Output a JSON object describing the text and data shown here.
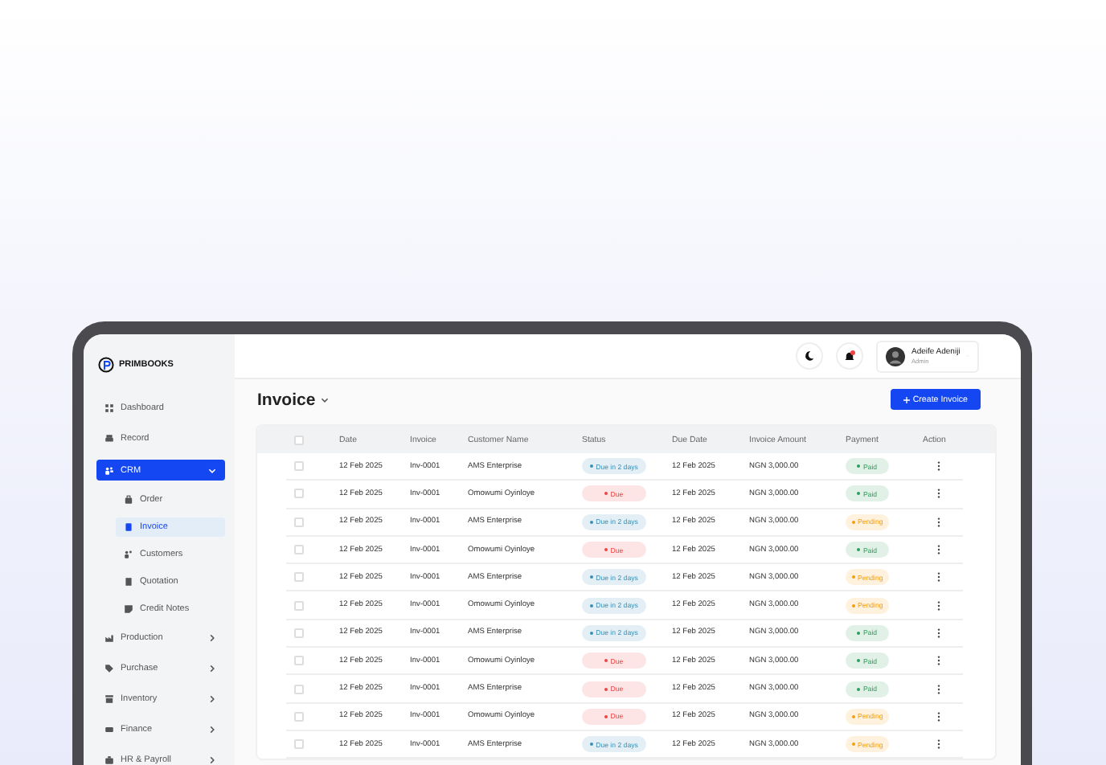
{
  "sidebar": {
    "brand": "PRIMBOOKS",
    "items": [
      {
        "label": "Dashboard",
        "kind": "link",
        "selected": false
      },
      {
        "label": "Record",
        "kind": "link",
        "selected": false
      },
      {
        "label": "CRM",
        "kind": "group",
        "selected": true,
        "expanded": true,
        "children": [
          {
            "label": "Order",
            "selected": false
          },
          {
            "label": "Invoice",
            "selected": true
          },
          {
            "label": "Customers",
            "selected": false
          },
          {
            "label": "Quotation",
            "selected": false
          },
          {
            "label": "Credit Notes",
            "selected": false
          }
        ]
      },
      {
        "label": "Production",
        "kind": "group",
        "selected": false,
        "expanded": false
      },
      {
        "label": "Purchase",
        "kind": "group",
        "selected": false,
        "expanded": false
      },
      {
        "label": "Inventory",
        "kind": "group",
        "selected": false,
        "expanded": false
      },
      {
        "label": "Finance",
        "kind": "group",
        "selected": false,
        "expanded": false
      },
      {
        "label": "HR & Payroll",
        "kind": "group",
        "selected": false,
        "expanded": false
      }
    ]
  },
  "topbar": {
    "user": {
      "name": "Adeife Adeniji",
      "role": "Admin"
    },
    "notification": true
  },
  "page": {
    "title": "Invoice",
    "create_button": "Create Invoice"
  },
  "table": {
    "select_all_checked": false,
    "columns": [
      "Date",
      "Invoice",
      "Customer Name",
      "Status",
      "Due Date",
      "Invoice Amount",
      "Payment",
      "Action"
    ],
    "rows": [
      {
        "checked": false,
        "date": "12 Feb 2025",
        "invoice": "Inv-0001",
        "customer": "AMS Enterprise",
        "status": {
          "text": "Due in 2 days",
          "color": "#3a8fb7"
        },
        "due_date": "12 Feb 2025",
        "amount": "NGN 3,000.00",
        "payment": {
          "text": "Paid",
          "color": "#2f9e5a"
        }
      },
      {
        "checked": false,
        "date": "12 Feb 2025",
        "invoice": "Inv-0001",
        "customer": "Omowumi Oyinloye",
        "status": {
          "text": "Due",
          "color": "#ef4444"
        },
        "due_date": "12 Feb 2025",
        "amount": "NGN 3,000.00",
        "payment": {
          "text": "Paid",
          "color": "#2f9e5a"
        }
      },
      {
        "checked": false,
        "date": "12 Feb 2025",
        "invoice": "Inv-0001",
        "customer": "AMS Enterprise",
        "status": {
          "text": "Due in 2 days",
          "color": "#3a8fb7"
        },
        "due_date": "12 Feb 2025",
        "amount": "NGN 3,000.00",
        "payment": {
          "text": "Pending",
          "color": "#f59e0b"
        }
      },
      {
        "checked": false,
        "date": "12 Feb 2025",
        "invoice": "Inv-0001",
        "customer": "Omowumi Oyinloye",
        "status": {
          "text": "Due",
          "color": "#ef4444"
        },
        "due_date": "12 Feb 2025",
        "amount": "NGN 3,000.00",
        "payment": {
          "text": "Paid",
          "color": "#2f9e5a"
        }
      },
      {
        "checked": false,
        "date": "12 Feb 2025",
        "invoice": "Inv-0001",
        "customer": "AMS Enterprise",
        "status": {
          "text": "Due in 2 days",
          "color": "#3a8fb7"
        },
        "due_date": "12 Feb 2025",
        "amount": "NGN 3,000.00",
        "payment": {
          "text": "Pending",
          "color": "#f59e0b"
        }
      },
      {
        "checked": false,
        "date": "12 Feb 2025",
        "invoice": "Inv-0001",
        "customer": "Omowumi Oyinloye",
        "status": {
          "text": "Due in 2 days",
          "color": "#3a8fb7"
        },
        "due_date": "12 Feb 2025",
        "amount": "NGN 3,000.00",
        "payment": {
          "text": "Pending",
          "color": "#f59e0b"
        }
      },
      {
        "checked": false,
        "date": "12 Feb 2025",
        "invoice": "Inv-0001",
        "customer": "AMS Enterprise",
        "status": {
          "text": "Due in 2 days",
          "color": "#3a8fb7"
        },
        "due_date": "12 Feb 2025",
        "amount": "NGN 3,000.00",
        "payment": {
          "text": "Paid",
          "color": "#2f9e5a"
        }
      },
      {
        "checked": false,
        "date": "12 Feb 2025",
        "invoice": "Inv-0001",
        "customer": "Omowumi Oyinloye",
        "status": {
          "text": "Due",
          "color": "#ef4444"
        },
        "due_date": "12 Feb 2025",
        "amount": "NGN 3,000.00",
        "payment": {
          "text": "Paid",
          "color": "#2f9e5a"
        }
      },
      {
        "checked": false,
        "date": "12 Feb 2025",
        "invoice": "Inv-0001",
        "customer": "AMS Enterprise",
        "status": {
          "text": "Due",
          "color": "#ef4444"
        },
        "due_date": "12 Feb 2025",
        "amount": "NGN 3,000.00",
        "payment": {
          "text": "Paid",
          "color": "#2f9e5a"
        }
      },
      {
        "checked": false,
        "date": "12 Feb 2025",
        "invoice": "Inv-0001",
        "customer": "Omowumi Oyinloye",
        "status": {
          "text": "Due",
          "color": "#ef4444"
        },
        "due_date": "12 Feb 2025",
        "amount": "NGN 3,000.00",
        "payment": {
          "text": "Pending",
          "color": "#f59e0b"
        }
      },
      {
        "checked": false,
        "date": "12 Feb 2025",
        "invoice": "Inv-0001",
        "customer": "AMS Enterprise",
        "status": {
          "text": "Due in 2 days",
          "color": "#3a8fb7"
        },
        "due_date": "12 Feb 2025",
        "amount": "NGN 3,000.00",
        "payment": {
          "text": "Pending",
          "color": "#f59e0b"
        }
      }
    ]
  }
}
